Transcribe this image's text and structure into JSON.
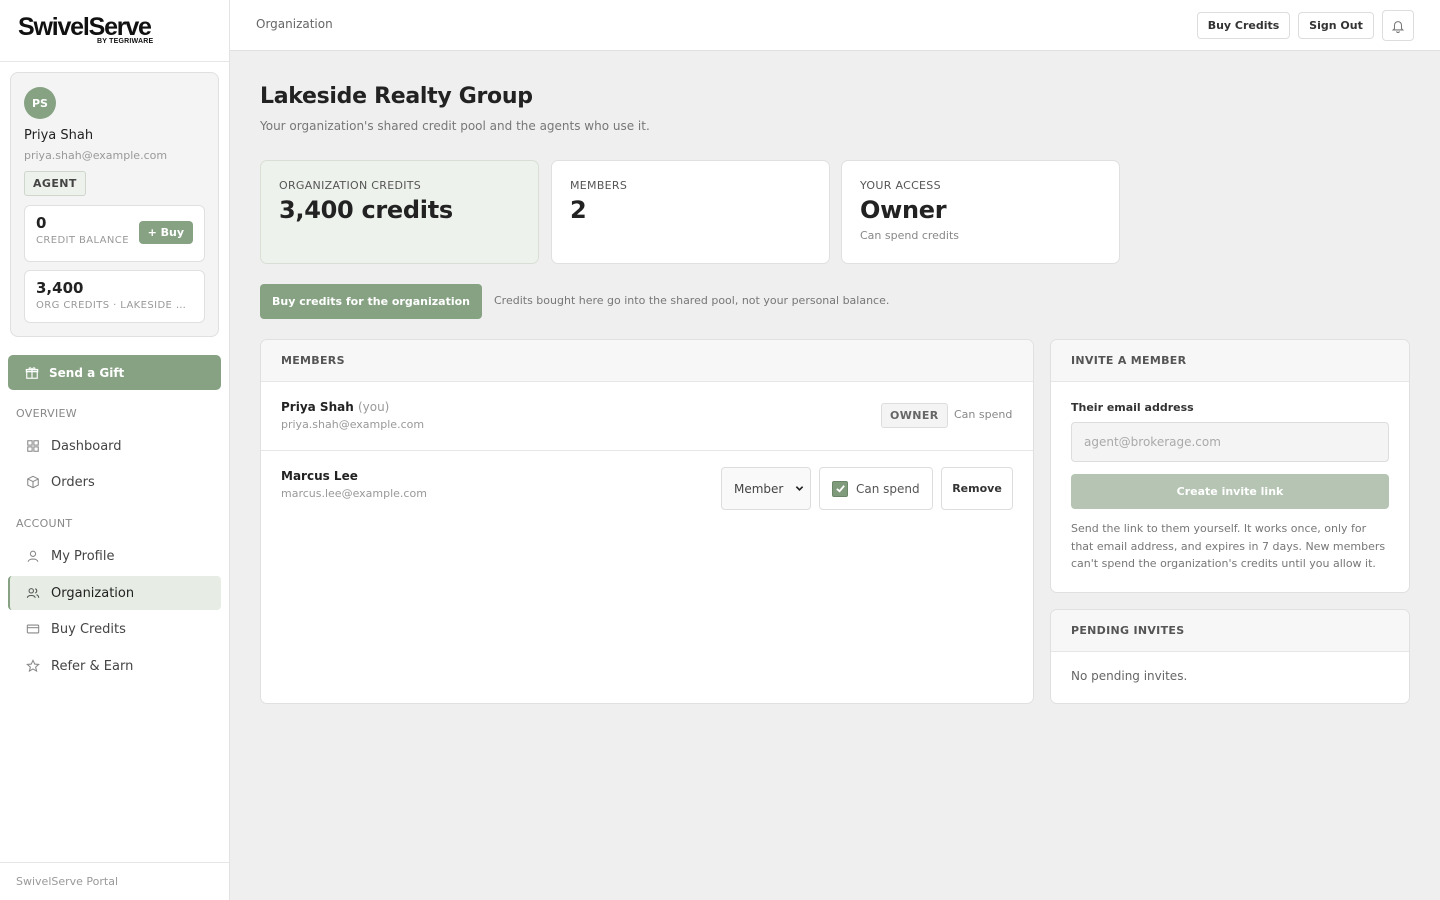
{
  "brand": {
    "name": "SwivelServe",
    "tagline": "BY TEGRIWARE"
  },
  "user": {
    "initials": "PS",
    "name": "Priya Shah",
    "email": "priya.shah@example.com",
    "role": "AGENT",
    "credit_balance": "0",
    "credit_balance_label": "CREDIT BALANCE",
    "buy_label": "+ Buy",
    "org_credits": "3,400",
    "org_credits_label": "ORG CREDITS · LAKESIDE REALTY GROUP"
  },
  "sidebar": {
    "gift_label": "Send a Gift",
    "sections": [
      {
        "title": "OVERVIEW",
        "items": [
          {
            "label": "Dashboard",
            "icon": "grid-icon"
          },
          {
            "label": "Orders",
            "icon": "box-icon"
          }
        ]
      },
      {
        "title": "ACCOUNT",
        "items": [
          {
            "label": "My Profile",
            "icon": "user-icon"
          },
          {
            "label": "Organization",
            "icon": "users-icon",
            "active": true
          },
          {
            "label": "Buy Credits",
            "icon": "card-icon"
          },
          {
            "label": "Refer & Earn",
            "icon": "star-icon"
          }
        ]
      }
    ],
    "footer": "SwivelServe Portal"
  },
  "topbar": {
    "breadcrumb": "Organization",
    "buy_credits_label": "Buy Credits",
    "sign_out_label": "Sign Out"
  },
  "page": {
    "title": "Lakeside Realty Group",
    "subtitle": "Your organization's shared credit pool and the agents who use it."
  },
  "stats": {
    "org_credits": {
      "label": "ORGANIZATION CREDITS",
      "value": "3,400 credits"
    },
    "members": {
      "label": "MEMBERS",
      "value": "2"
    },
    "access": {
      "label": "YOUR ACCESS",
      "value": "Owner",
      "sub": "Can spend credits"
    }
  },
  "org_buy": {
    "label": "Buy credits for the organization",
    "note": "Credits bought here go into the shared pool, not your personal balance."
  },
  "members_panel": {
    "title": "MEMBERS",
    "you_suffix": "(you)",
    "rows": [
      {
        "name": "Priya Shah",
        "email": "priya.shah@example.com",
        "badge": "OWNER",
        "spend_text": "Can spend"
      },
      {
        "name": "Marcus Lee",
        "email": "marcus.lee@example.com",
        "role_value": "Member",
        "spend_label": "Can spend",
        "spend_checked": true,
        "remove_label": "Remove"
      }
    ]
  },
  "invite_panel": {
    "title": "INVITE A MEMBER",
    "field_label": "Their email address",
    "placeholder": "agent@brokerage.com",
    "button_label": "Create invite link",
    "note": "Send the link to them yourself. It works once, only for that email address, and expires in 7 days. New members can't spend the organization's credits until you allow it."
  },
  "pending_panel": {
    "title": "PENDING INVITES",
    "empty_text": "No pending invites."
  },
  "colors": {
    "accent": "#86a283",
    "accent_light": "#eef2ec",
    "disabled": "#b5c4b3"
  }
}
